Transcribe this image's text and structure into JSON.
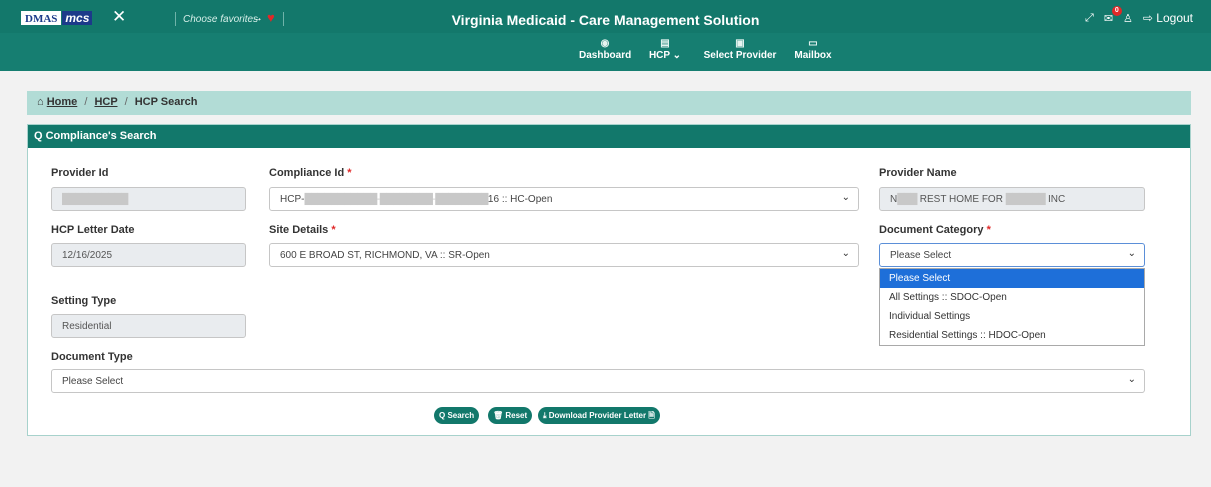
{
  "header": {
    "logo_left": "DMAS",
    "logo_right": "mcs",
    "close_glyph": "✕",
    "favorites_label": "Choose favorites",
    "favorites_arrow": "→",
    "heart_glyph": "♥",
    "title": "Virginia Medicaid - Care Management Solution",
    "expand_glyph": "⤢",
    "mail_glyph": "✉",
    "mail_badge": "0",
    "user_glyph": "♙",
    "logout_label": "⇨ Logout"
  },
  "nav": {
    "items": [
      {
        "icon": "◉",
        "label": "Dashboard",
        "icon_name": "dashboard-icon"
      },
      {
        "icon": "▤",
        "label": "HCP ⌄",
        "icon_name": "hcp-icon"
      },
      {
        "icon": "▣",
        "label": "Select Provider",
        "icon_name": "provider-icon"
      },
      {
        "icon": "▭",
        "label": "Mailbox",
        "icon_name": "mailbox-icon"
      }
    ]
  },
  "breadcrumb": {
    "home_icon": "⌂",
    "home": "Home",
    "sep": "/",
    "hcp": "HCP",
    "current": "HCP Search"
  },
  "card": {
    "title": "Q Compliance's Search"
  },
  "form": {
    "provider_id_label": "Provider Id",
    "provider_id_value": "██████████",
    "compliance_id_label": "Compliance Id",
    "compliance_id_prefix": "HCP-",
    "compliance_id_blur": "███████████-████████-████████",
    "compliance_id_suffix": "16 :: HC-Open",
    "provider_name_label": "Provider Name",
    "provider_name_prefix": "N",
    "provider_name_blur": "███",
    "provider_name_mid": " REST HOME FOR ",
    "provider_name_blur2": "██████",
    "provider_name_suffix": " INC",
    "hcp_letter_date_label": "HCP Letter Date",
    "hcp_letter_date_value": "12/16/2025",
    "site_details_label": "Site Details",
    "site_details_value": "600 E BROAD ST, RICHMOND, VA :: SR-Open",
    "document_category_label": "Document Category",
    "document_category_value": "Please Select",
    "setting_type_label": "Setting Type",
    "setting_type_value": "Residential",
    "document_type_label": "Document Type",
    "document_type_value": "Please Select",
    "required_mark": "*",
    "caret": "⌄"
  },
  "dropdown": {
    "options": [
      "Please Select",
      "All Settings :: SDOC-Open",
      "Individual Settings",
      "Residential Settings :: HDOC-Open"
    ],
    "selected_index": 0
  },
  "buttons": {
    "search": "Q Search",
    "reset": "🗑 Reset",
    "download": "⤓ Download Provider Letter 🗎"
  }
}
